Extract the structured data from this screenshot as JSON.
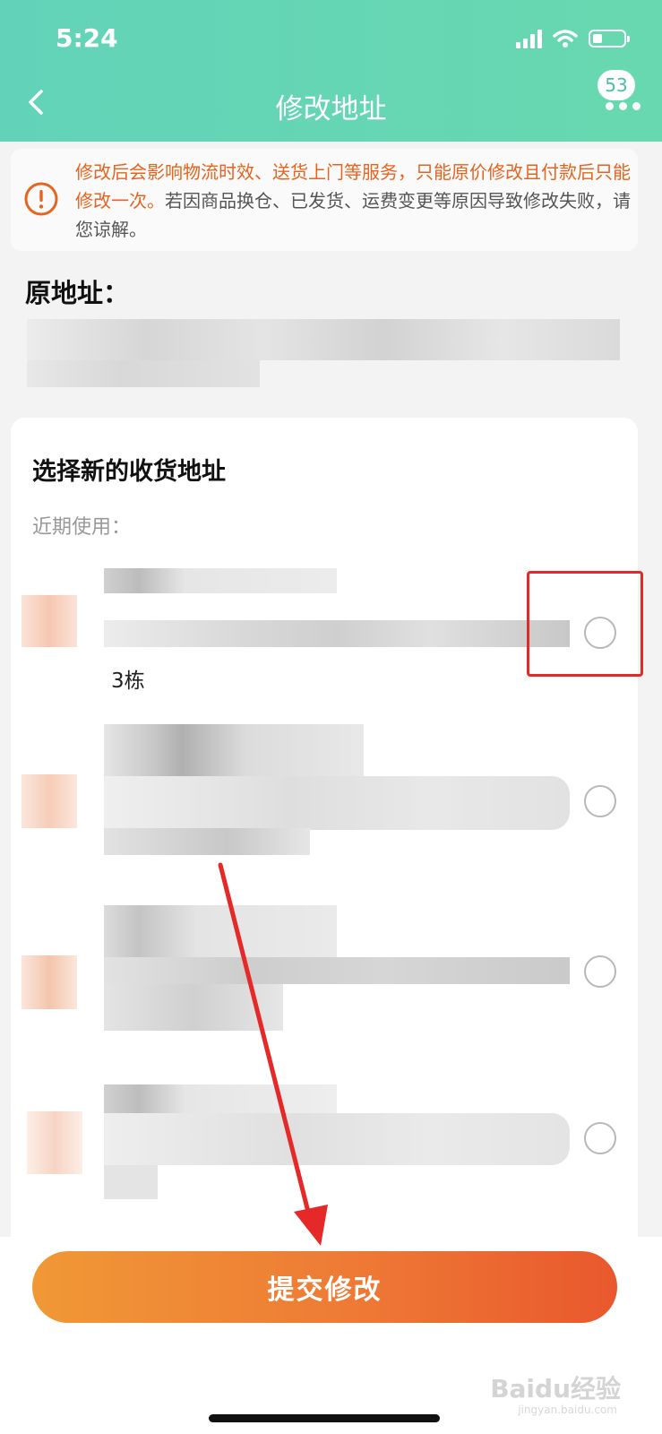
{
  "status_bar": {
    "time": "5:24"
  },
  "header": {
    "title": "修改地址",
    "message_count": "53"
  },
  "notice": {
    "highlight": "修改后会影响物流时效、送货上门等服务，只能原价修改且付款后只能修改一次。",
    "text": "若因商品换仓、已发货、运费变更等原因导致修改失败，请您谅解。"
  },
  "original_address": {
    "label": "原地址："
  },
  "new_address": {
    "title": "选择新的收货地址",
    "recent_label": "近期使用：",
    "items": [
      {
        "suffix": "3栋",
        "selected": false
      },
      {
        "suffix": "",
        "selected": false
      },
      {
        "suffix": "",
        "selected": false
      },
      {
        "suffix": "",
        "selected": false
      }
    ]
  },
  "submit_button": {
    "label": "提交修改"
  },
  "watermark": {
    "text": "Baidu经验",
    "sub": "jingyan.baidu.com"
  },
  "colors": {
    "header": "#62d3b8",
    "notice_orange": "#e7641e",
    "button_start": "#f09836",
    "button_end": "#e9582d",
    "annotation_red": "#e52828"
  }
}
